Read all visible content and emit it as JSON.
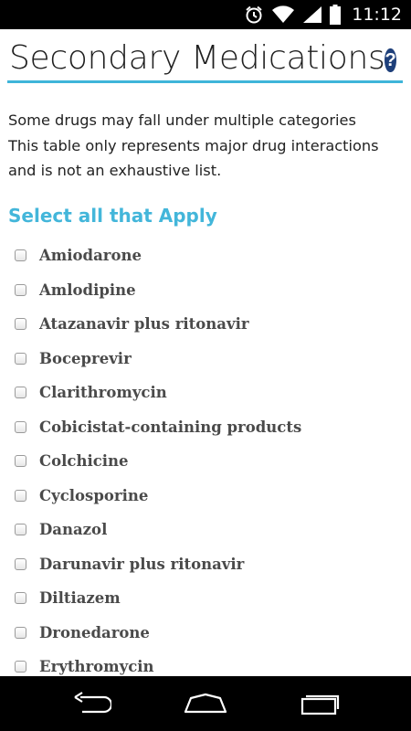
{
  "status_bar": {
    "time": "11:12",
    "icons": [
      "alarm-icon",
      "wifi-icon",
      "signal-icon",
      "battery-icon"
    ]
  },
  "header": {
    "title": "Secondary Medications",
    "help_icon": "help-icon",
    "help_symbol": "?"
  },
  "description": {
    "lines": [
      "Some drugs may fall under multiple categories",
      "This table only represents major drug interactions",
      "and is not an exhaustive list."
    ]
  },
  "section": {
    "heading": "Select all that Apply"
  },
  "medications": [
    "Amiodarone",
    "Amlodipine",
    "Atazanavir plus ritonavir",
    "Boceprevir",
    "Clarithromycin",
    "Cobicistat-containing products",
    "Colchicine",
    "Cyclosporine",
    "Danazol",
    "Darunavir plus ritonavir",
    "Diltiazem",
    "Dronedarone",
    "Erythromycin"
  ],
  "nav_bar": {
    "icons": [
      "back-icon",
      "home-icon",
      "recent-apps-icon"
    ]
  },
  "colors": {
    "accent": "#43b6da",
    "help_icon_bg": "#1e3f7a",
    "label_text": "#4a4a4a"
  }
}
